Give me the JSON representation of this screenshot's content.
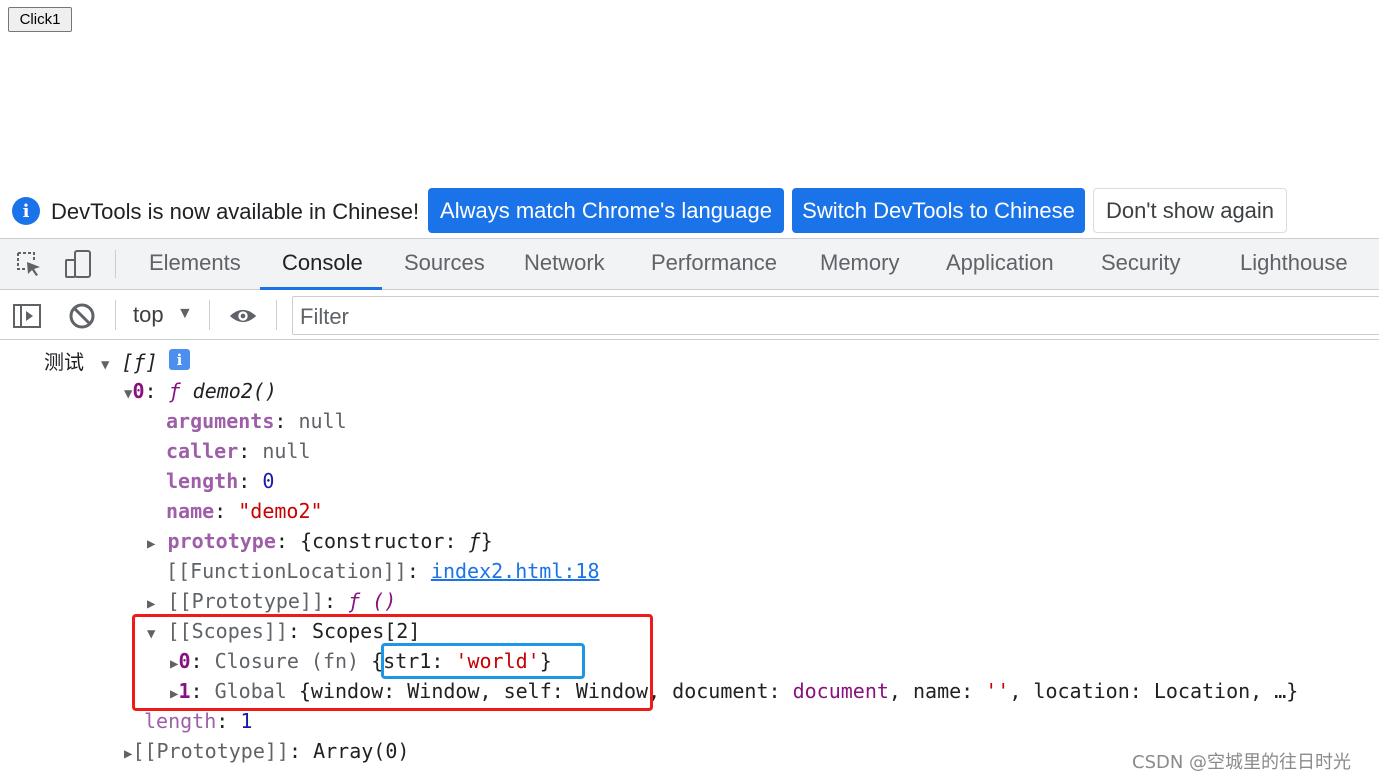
{
  "page": {
    "button_label": "Click1"
  },
  "infobar": {
    "message": "DevTools is now available in Chinese!",
    "btn_match": "Always match Chrome's language",
    "btn_switch": "Switch DevTools to Chinese",
    "btn_dismiss": "Don't show again"
  },
  "tabs": [
    "Elements",
    "Console",
    "Sources",
    "Network",
    "Performance",
    "Memory",
    "Application",
    "Security",
    "Lighthouse"
  ],
  "active_tab": "Console",
  "toolbar": {
    "context": "top",
    "filter_placeholder": "Filter"
  },
  "console": {
    "log_label": "测试",
    "array_preview": "[ƒ]",
    "item0": {
      "index": "0",
      "sig_f": "ƒ",
      "sig_name": "demo2()"
    },
    "arguments": {
      "key": "arguments",
      "value": "null"
    },
    "caller": {
      "key": "caller",
      "value": "null"
    },
    "length_fn": {
      "key": "length",
      "value": "0"
    },
    "name": {
      "key": "name",
      "value": "\"demo2\""
    },
    "prototype": {
      "key": "prototype",
      "value_open": "{constructor: ",
      "value_f": "ƒ",
      "value_close": "}"
    },
    "function_location": {
      "key": "[[FunctionLocation]]",
      "link": "index2.html:18"
    },
    "proto_fn": {
      "key": "[[Prototype]]",
      "value": "ƒ ()"
    },
    "scopes": {
      "key": "[[Scopes]]",
      "value": "Scopes[2]"
    },
    "scope0": {
      "index": "0",
      "label": "Closure (fn)",
      "open": "{str1: ",
      "val": "'world'",
      "close": "}"
    },
    "scope1": {
      "index": "1",
      "label": "Global",
      "p1": "{window: ",
      "v1": "Window",
      "p2": ", self: ",
      "v2": "Window",
      "p3": ", document: ",
      "v3": "document",
      "p4": ", name: ",
      "v4": "''",
      "p5": ", location: ",
      "v5": "Location",
      "p6": ", …}"
    },
    "length_arr": {
      "key": "length",
      "value": "1"
    },
    "proto_arr": {
      "key": "[[Prototype]]",
      "value": "Array(0)"
    }
  },
  "watermark": "CSDN @空城里的往日时光",
  "colors": {
    "accent": "#1a73e8",
    "annotation_red": "#ef1b1b",
    "annotation_blue": "#1e96e6"
  }
}
